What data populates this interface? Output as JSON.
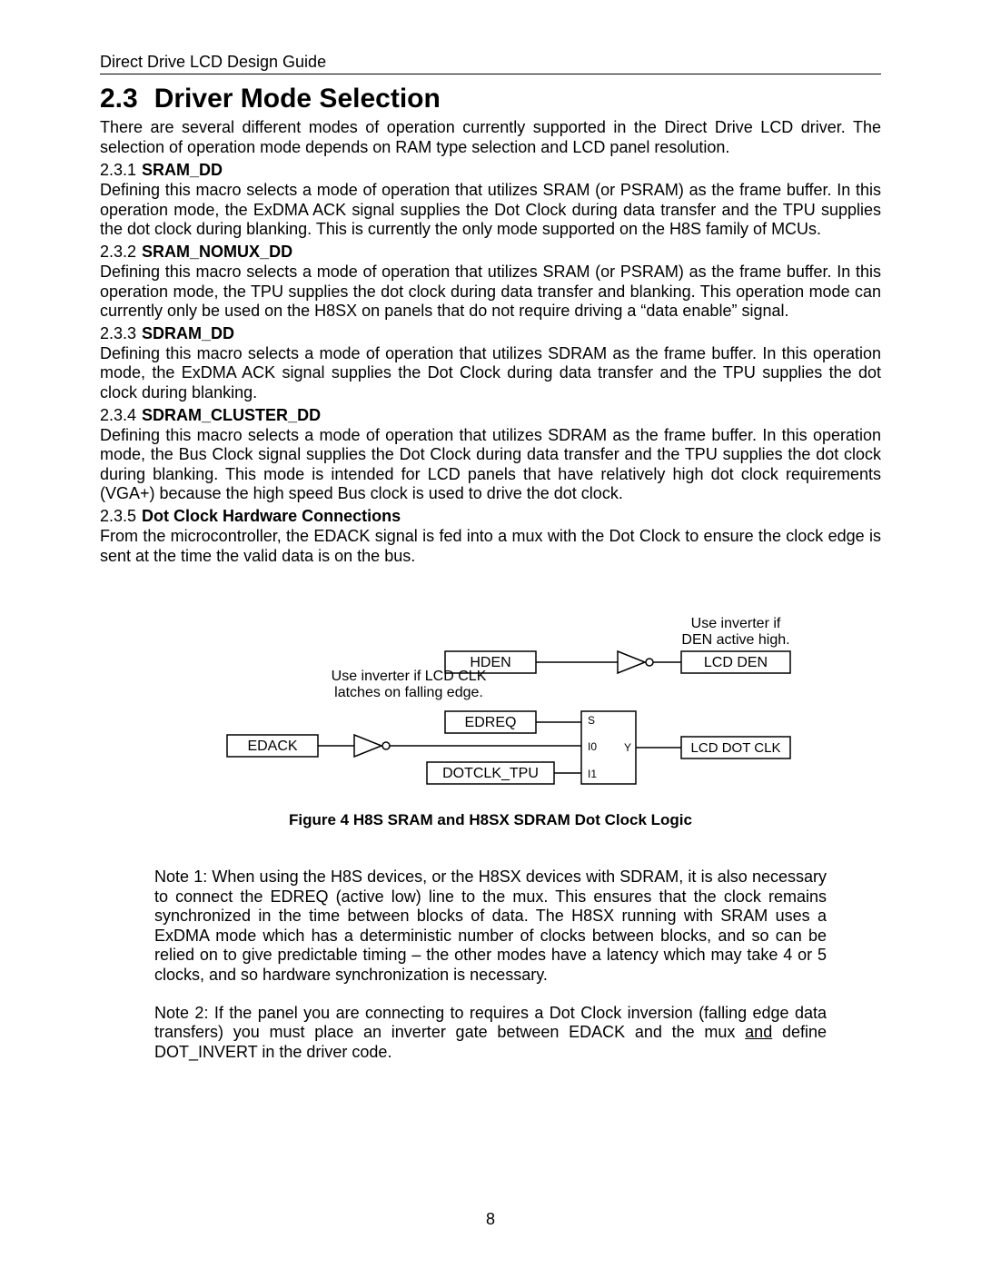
{
  "header": "Direct Drive LCD Design Guide",
  "section": {
    "num": "2.3",
    "title": "Driver Mode Selection"
  },
  "intro": "There are several different modes of operation currently supported in the Direct Drive LCD driver. The selection of operation mode depends on RAM type selection and LCD panel resolution.",
  "s1": {
    "num": "2.3.1",
    "title": "SRAM_DD",
    "body": "Defining this macro selects a mode of operation that utilizes SRAM (or PSRAM) as the frame buffer. In this operation mode, the ExDMA ACK signal supplies the Dot Clock during data transfer and the TPU supplies the dot clock during blanking. This is currently the only mode supported on the H8S family of MCUs."
  },
  "s2": {
    "num": "2.3.2",
    "title": "SRAM_NOMUX_DD",
    "body": "Defining this macro selects a mode of operation that utilizes SRAM (or PSRAM) as the frame buffer. In this operation mode, the TPU supplies the dot clock during data transfer and blanking. This operation mode can currently only be used on the H8SX on panels that do not require driving a “data enable” signal."
  },
  "s3": {
    "num": "2.3.3",
    "title": "SDRAM_DD",
    "body": "Defining this macro selects a mode of operation that utilizes SDRAM as the frame buffer. In this operation mode, the ExDMA ACK signal supplies the Dot Clock during data transfer and the TPU supplies the dot clock during blanking."
  },
  "s4": {
    "num": "2.3.4",
    "title": "SDRAM_CLUSTER_DD",
    "body": "Defining this macro selects a mode of operation that utilizes SDRAM as the frame buffer. In this operation mode, the Bus Clock signal supplies the Dot Clock during data transfer and the TPU supplies the dot clock during blanking. This mode is intended for LCD panels that have relatively high dot clock requirements (VGA+) because the high speed Bus clock is used to drive the dot clock."
  },
  "s5": {
    "num": "2.3.5",
    "title": "Dot Clock Hardware Connections",
    "body": "From the microcontroller, the EDACK signal is fed into a mux with the Dot Clock to ensure the clock edge is sent at the time the valid data is on the bus."
  },
  "diagram": {
    "annot_top": "Use inverter if DEN active high.",
    "annot_left1": "Use inverter if LCD CLK",
    "annot_left2": "latches on falling edge.",
    "hden": "HDEN",
    "edreq": "EDREQ",
    "dotclk": "DOTCLK_TPU",
    "edack": "EDACK",
    "lcdden": "LCD DEN",
    "lcddot": "LCD DOT CLK",
    "mux_s": "S",
    "mux_i0": "I0",
    "mux_i1": "I1",
    "mux_y": "Y"
  },
  "caption": "Figure 4 H8S SRAM and H8SX SDRAM Dot Clock Logic",
  "note1": "Note 1: When using the H8S devices, or the H8SX devices with SDRAM, it is also necessary to connect the EDREQ (active low) line to the mux. This ensures that the clock remains synchronized in the time between blocks of data. The H8SX running with SRAM uses a ExDMA mode which has a deterministic number of clocks between blocks, and so can be relied on to give predictable timing – the other modes have a latency which may take 4 or 5 clocks, and so hardware synchronization is necessary.",
  "note2a": "Note 2: If the panel you are connecting to requires a Dot Clock inversion (falling edge data transfers) you must place an inverter gate between EDACK and the mux ",
  "note2u": "and",
  "note2b": " define DOT_INVERT in the driver code.",
  "pagenum": "8"
}
